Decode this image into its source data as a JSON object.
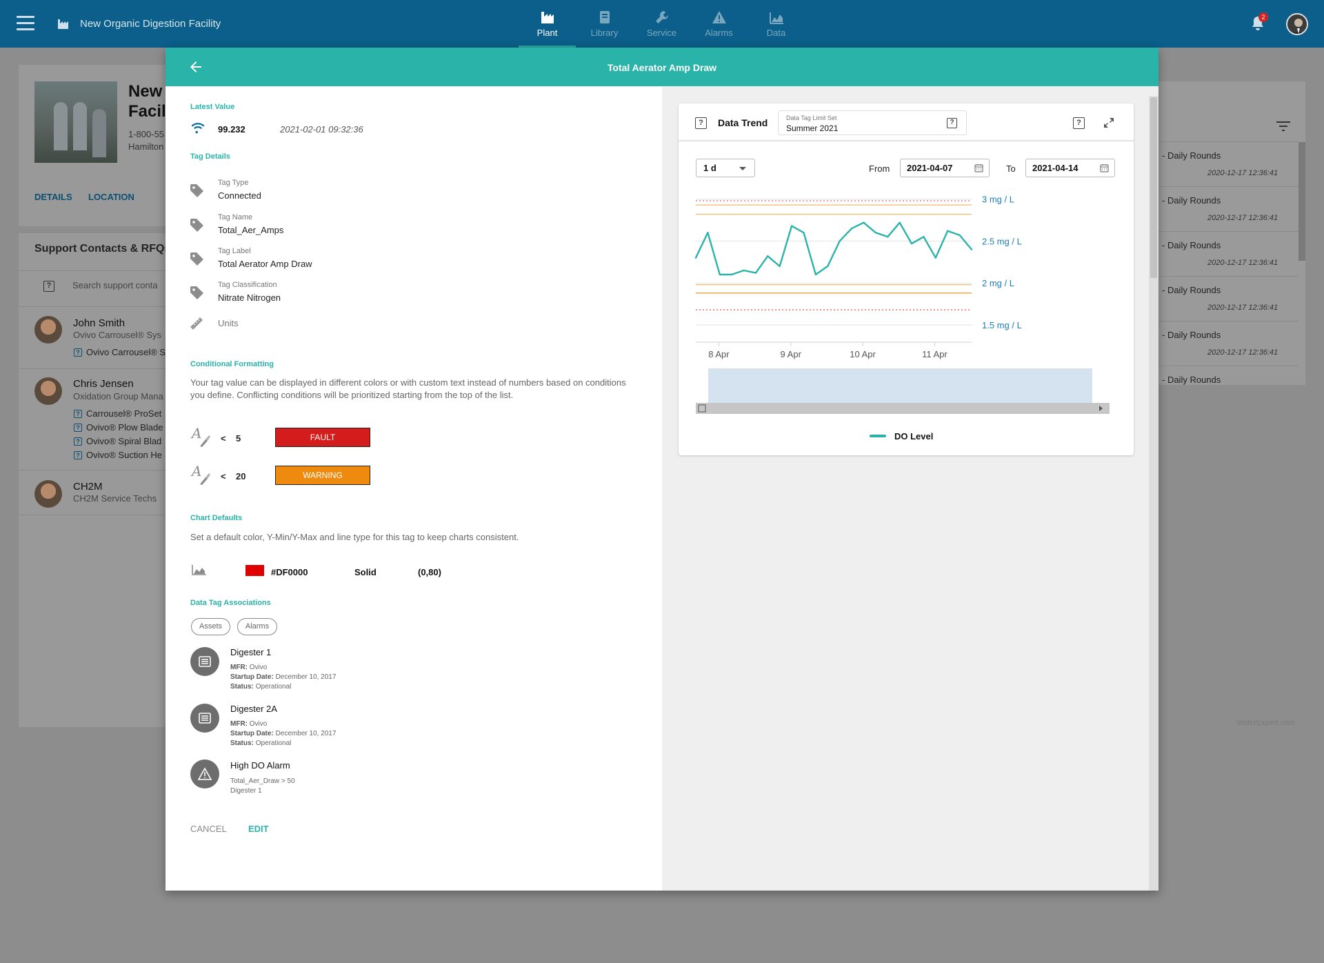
{
  "topnav": {
    "facility": "New Organic Digestion Facility",
    "tabs": [
      {
        "label": "Plant",
        "icon": "factory-icon"
      },
      {
        "label": "Library",
        "icon": "book-icon"
      },
      {
        "label": "Service",
        "icon": "wrench-icon"
      },
      {
        "label": "Alarms",
        "icon": "warning-icon"
      },
      {
        "label": "Data",
        "icon": "area-chart-icon"
      }
    ],
    "active_tab": "Plant",
    "notification_count": "2"
  },
  "background": {
    "title": "New Facility",
    "title_line1": "New",
    "title_line2": "Facili",
    "phone": "1-800-55",
    "city": "Hamilton",
    "tab_details": "DETAILS",
    "tab_location": "LOCATION",
    "support_title": "Support Contacts & RFQs",
    "search_placeholder": "Search support conta",
    "contacts": [
      {
        "name": "John Smith",
        "sub": "Ovivo Carrousel® Sys",
        "items": [
          "Ovivo Carrousel® S"
        ]
      },
      {
        "name": "Chris Jensen",
        "sub": "Oxidation Group Mana",
        "items": [
          "Carrousel® ProSet",
          "Ovivo® Plow Blade",
          "Ovivo® Spiral Blad",
          "Ovivo® Suction He"
        ]
      },
      {
        "name": "CH2M",
        "sub": "CH2M Service Techs",
        "items": []
      }
    ],
    "rounds": [
      {
        "label": "- Daily Rounds",
        "date": "2020-12-17 12:36:41"
      },
      {
        "label": "- Daily Rounds",
        "date": "2020-12-17 12:36:41"
      },
      {
        "label": "- Daily Rounds",
        "date": "2020-12-17 12:36:41"
      },
      {
        "label": "- Daily Rounds",
        "date": "2020-12-17 12:36:41"
      },
      {
        "label": "- Daily Rounds",
        "date": "2020-12-17 12:36:41"
      },
      {
        "label": "- Daily Rounds",
        "date": ""
      }
    ],
    "watermark": "WaterExpert.com"
  },
  "modal": {
    "title": "Total Aerator Amp Draw",
    "latest_value_title": "Latest Value",
    "latest_value": "99.232",
    "latest_timestamp": "2021-02-01 09:32:36",
    "tag_details_title": "Tag Details",
    "tag_details": [
      {
        "label": "Tag Type",
        "value": "Connected"
      },
      {
        "label": "Tag Name",
        "value": "Total_Aer_Amps"
      },
      {
        "label": "Tag Label",
        "value": "Total Aerator Amp Draw"
      },
      {
        "label": "Tag Classification",
        "value": "Nitrate Nitrogen"
      }
    ],
    "units_label": "Units",
    "conditional_title": "Conditional Formatting",
    "conditional_desc": "Your tag value can be displayed in different colors or with custom text instead of numbers based on conditions you define. Conflicting conditions will be prioritized starting from the top of the list.",
    "conditions": [
      {
        "operator": "<",
        "value": "5",
        "label": "FAULT",
        "color": "#d41c1c"
      },
      {
        "operator": "<",
        "value": "20",
        "label": "WARNING",
        "color": "#ee8b0e"
      }
    ],
    "chart_defaults_title": "Chart Defaults",
    "chart_defaults_desc": "Set a default color, Y-Min/Y-Max and line type for this tag to keep charts consistent.",
    "chart_defaults": {
      "color": "#DF0000",
      "line_type": "Solid",
      "range": "(0,80)"
    },
    "associations_title": "Data Tag Associations",
    "chips": [
      "Assets",
      "Alarms"
    ],
    "associations": [
      {
        "title": "Digester 1",
        "mfr_label": "MFR:",
        "mfr": "Ovivo",
        "startup_label": "Startup Date:",
        "startup": "December 10, 2017",
        "status_label": "Status:",
        "status": "Operational"
      },
      {
        "title": "Digester 2A",
        "mfr_label": "MFR:",
        "mfr": "Ovivo",
        "startup_label": "Startup Date:",
        "startup": "December 10, 2017",
        "status_label": "Status:",
        "status": "Operational"
      }
    ],
    "alarm": {
      "title": "High DO Alarm",
      "condition": "Total_Aer_Draw > 50",
      "asset": "Digester 1"
    },
    "cancel": "CANCEL",
    "edit": "EDIT"
  },
  "trend": {
    "title": "Data Trend",
    "limit_set_label": "Data Tag Limit Set",
    "limit_set_value": "Summer 2021",
    "range": "1 d",
    "from_label": "From",
    "from": "2021-04-07",
    "to_label": "To",
    "to": "2021-04-14",
    "legend": "DO Level"
  },
  "chart_data": {
    "type": "line",
    "series": [
      {
        "name": "DO Level",
        "color": "#2ab3a9",
        "x": [
          "2021-04-07 20:00",
          "2021-04-08 00:00",
          "2021-04-08 04:00",
          "2021-04-08 08:00",
          "2021-04-08 12:00",
          "2021-04-08 16:00",
          "2021-04-08 20:00",
          "2021-04-09 00:00",
          "2021-04-09 04:00",
          "2021-04-09 08:00",
          "2021-04-09 12:00",
          "2021-04-09 16:00",
          "2021-04-09 20:00",
          "2021-04-10 00:00",
          "2021-04-10 04:00",
          "2021-04-10 08:00",
          "2021-04-10 12:00",
          "2021-04-10 16:00",
          "2021-04-10 20:00",
          "2021-04-11 00:00",
          "2021-04-11 04:00",
          "2021-04-11 08:00",
          "2021-04-11 12:00",
          "2021-04-11 16:00"
        ],
        "values": [
          2.3,
          2.6,
          2.1,
          2.1,
          2.15,
          2.12,
          2.32,
          2.2,
          2.68,
          2.6,
          2.1,
          2.2,
          2.5,
          2.65,
          2.72,
          2.6,
          2.55,
          2.72,
          2.47,
          2.55,
          2.3,
          2.62,
          2.57,
          2.4
        ]
      }
    ],
    "series_values_note": "",
    "x_ticks": [
      "8 Apr",
      "9 Apr",
      "10 Apr",
      "11 Apr"
    ],
    "y_ticks": [
      "3 mg / L",
      "2.5 mg / L",
      "2 mg / L",
      "1.5 mg / L"
    ],
    "y_tick_values": [
      3,
      2.5,
      2,
      1.5
    ],
    "ylim": [
      1.36,
      3.03
    ],
    "limit_lines": [
      {
        "value": 2.98,
        "style": "dotted",
        "color": "#e05050"
      },
      {
        "value": 2.93,
        "style": "solid",
        "color": "#f2b968"
      },
      {
        "value": 2.82,
        "style": "solid",
        "color": "#f2b968"
      },
      {
        "value": 1.98,
        "style": "solid",
        "color": "#f2b968"
      },
      {
        "value": 1.88,
        "style": "solid",
        "color": "#ee8b0e"
      },
      {
        "value": 1.68,
        "style": "dotted",
        "color": "#e05050"
      }
    ],
    "grid": true,
    "legend_position": "bottom"
  }
}
